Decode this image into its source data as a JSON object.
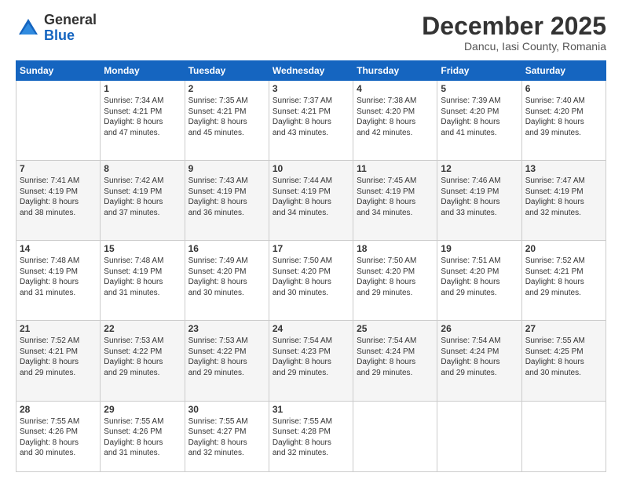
{
  "header": {
    "logo_general": "General",
    "logo_blue": "Blue",
    "month_title": "December 2025",
    "subtitle": "Dancu, Iasi County, Romania"
  },
  "weekdays": [
    "Sunday",
    "Monday",
    "Tuesday",
    "Wednesday",
    "Thursday",
    "Friday",
    "Saturday"
  ],
  "weeks": [
    [
      {
        "day": "",
        "info": ""
      },
      {
        "day": "1",
        "info": "Sunrise: 7:34 AM\nSunset: 4:21 PM\nDaylight: 8 hours\nand 47 minutes."
      },
      {
        "day": "2",
        "info": "Sunrise: 7:35 AM\nSunset: 4:21 PM\nDaylight: 8 hours\nand 45 minutes."
      },
      {
        "day": "3",
        "info": "Sunrise: 7:37 AM\nSunset: 4:21 PM\nDaylight: 8 hours\nand 43 minutes."
      },
      {
        "day": "4",
        "info": "Sunrise: 7:38 AM\nSunset: 4:20 PM\nDaylight: 8 hours\nand 42 minutes."
      },
      {
        "day": "5",
        "info": "Sunrise: 7:39 AM\nSunset: 4:20 PM\nDaylight: 8 hours\nand 41 minutes."
      },
      {
        "day": "6",
        "info": "Sunrise: 7:40 AM\nSunset: 4:20 PM\nDaylight: 8 hours\nand 39 minutes."
      }
    ],
    [
      {
        "day": "7",
        "info": "Sunrise: 7:41 AM\nSunset: 4:19 PM\nDaylight: 8 hours\nand 38 minutes."
      },
      {
        "day": "8",
        "info": "Sunrise: 7:42 AM\nSunset: 4:19 PM\nDaylight: 8 hours\nand 37 minutes."
      },
      {
        "day": "9",
        "info": "Sunrise: 7:43 AM\nSunset: 4:19 PM\nDaylight: 8 hours\nand 36 minutes."
      },
      {
        "day": "10",
        "info": "Sunrise: 7:44 AM\nSunset: 4:19 PM\nDaylight: 8 hours\nand 34 minutes."
      },
      {
        "day": "11",
        "info": "Sunrise: 7:45 AM\nSunset: 4:19 PM\nDaylight: 8 hours\nand 34 minutes."
      },
      {
        "day": "12",
        "info": "Sunrise: 7:46 AM\nSunset: 4:19 PM\nDaylight: 8 hours\nand 33 minutes."
      },
      {
        "day": "13",
        "info": "Sunrise: 7:47 AM\nSunset: 4:19 PM\nDaylight: 8 hours\nand 32 minutes."
      }
    ],
    [
      {
        "day": "14",
        "info": "Sunrise: 7:48 AM\nSunset: 4:19 PM\nDaylight: 8 hours\nand 31 minutes."
      },
      {
        "day": "15",
        "info": "Sunrise: 7:48 AM\nSunset: 4:19 PM\nDaylight: 8 hours\nand 31 minutes."
      },
      {
        "day": "16",
        "info": "Sunrise: 7:49 AM\nSunset: 4:20 PM\nDaylight: 8 hours\nand 30 minutes."
      },
      {
        "day": "17",
        "info": "Sunrise: 7:50 AM\nSunset: 4:20 PM\nDaylight: 8 hours\nand 30 minutes."
      },
      {
        "day": "18",
        "info": "Sunrise: 7:50 AM\nSunset: 4:20 PM\nDaylight: 8 hours\nand 29 minutes."
      },
      {
        "day": "19",
        "info": "Sunrise: 7:51 AM\nSunset: 4:20 PM\nDaylight: 8 hours\nand 29 minutes."
      },
      {
        "day": "20",
        "info": "Sunrise: 7:52 AM\nSunset: 4:21 PM\nDaylight: 8 hours\nand 29 minutes."
      }
    ],
    [
      {
        "day": "21",
        "info": "Sunrise: 7:52 AM\nSunset: 4:21 PM\nDaylight: 8 hours\nand 29 minutes."
      },
      {
        "day": "22",
        "info": "Sunrise: 7:53 AM\nSunset: 4:22 PM\nDaylight: 8 hours\nand 29 minutes."
      },
      {
        "day": "23",
        "info": "Sunrise: 7:53 AM\nSunset: 4:22 PM\nDaylight: 8 hours\nand 29 minutes."
      },
      {
        "day": "24",
        "info": "Sunrise: 7:54 AM\nSunset: 4:23 PM\nDaylight: 8 hours\nand 29 minutes."
      },
      {
        "day": "25",
        "info": "Sunrise: 7:54 AM\nSunset: 4:24 PM\nDaylight: 8 hours\nand 29 minutes."
      },
      {
        "day": "26",
        "info": "Sunrise: 7:54 AM\nSunset: 4:24 PM\nDaylight: 8 hours\nand 29 minutes."
      },
      {
        "day": "27",
        "info": "Sunrise: 7:55 AM\nSunset: 4:25 PM\nDaylight: 8 hours\nand 30 minutes."
      }
    ],
    [
      {
        "day": "28",
        "info": "Sunrise: 7:55 AM\nSunset: 4:26 PM\nDaylight: 8 hours\nand 30 minutes."
      },
      {
        "day": "29",
        "info": "Sunrise: 7:55 AM\nSunset: 4:26 PM\nDaylight: 8 hours\nand 31 minutes."
      },
      {
        "day": "30",
        "info": "Sunrise: 7:55 AM\nSunset: 4:27 PM\nDaylight: 8 hours\nand 32 minutes."
      },
      {
        "day": "31",
        "info": "Sunrise: 7:55 AM\nSunset: 4:28 PM\nDaylight: 8 hours\nand 32 minutes."
      },
      {
        "day": "",
        "info": ""
      },
      {
        "day": "",
        "info": ""
      },
      {
        "day": "",
        "info": ""
      }
    ]
  ]
}
